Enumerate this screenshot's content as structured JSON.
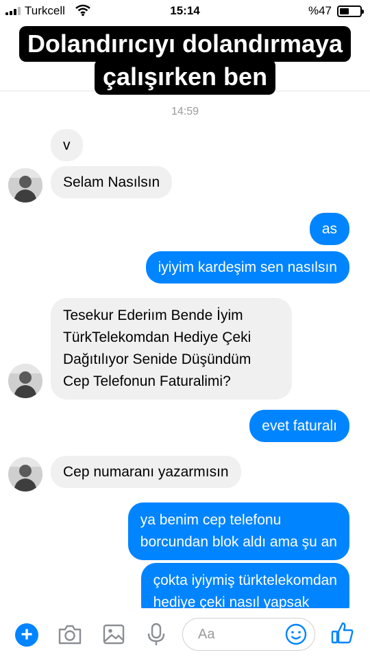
{
  "status_bar": {
    "carrier": "Turkcell",
    "time": "15:14",
    "battery_percent": "%47",
    "battery_level": 0.47,
    "signal_icon": "signal-bars-icon",
    "wifi_icon": "wifi-icon",
    "battery_icon": "battery-icon"
  },
  "caption": {
    "line1": "Dolandırıcıyı dolandırmaya",
    "line2": "çalışırken ben"
  },
  "chat": {
    "timestamp": "14:59",
    "messages": [
      {
        "side": "in",
        "text": "v"
      },
      {
        "side": "in",
        "text": "Selam Nasılsın"
      },
      {
        "side": "out",
        "text": "as"
      },
      {
        "side": "out",
        "text": "iyiyim kardeşim sen nasılsın"
      },
      {
        "side": "in",
        "text": "Tesekur Ederiım Bende İyim\nTürkTelekomdan Hediye Çeki\nDağıtılıyor Senide Düşündüm\nCep Telefonun Faturalimi?"
      },
      {
        "side": "out",
        "text": "evet faturalı"
      },
      {
        "side": "in",
        "text": "Cep numaranı yazarmısın"
      },
      {
        "side": "out",
        "text": "ya benim cep telefonu\nborcundan blok aldı ama şu an"
      },
      {
        "side": "out",
        "text": "çokta iyiymiş türktelekomdan\nhediye çeki nasıl yapsak"
      }
    ]
  },
  "composer": {
    "placeholder": "Aa",
    "accent_color": "#0084ff",
    "icons": [
      "plus-icon",
      "camera-icon",
      "image-icon",
      "microphone-icon",
      "smiley-icon",
      "thumbs-up-icon"
    ]
  },
  "colors": {
    "outgoing_bubble": "#0084ff",
    "incoming_bubble": "#f0f0f0",
    "caption_background": "#000000"
  }
}
